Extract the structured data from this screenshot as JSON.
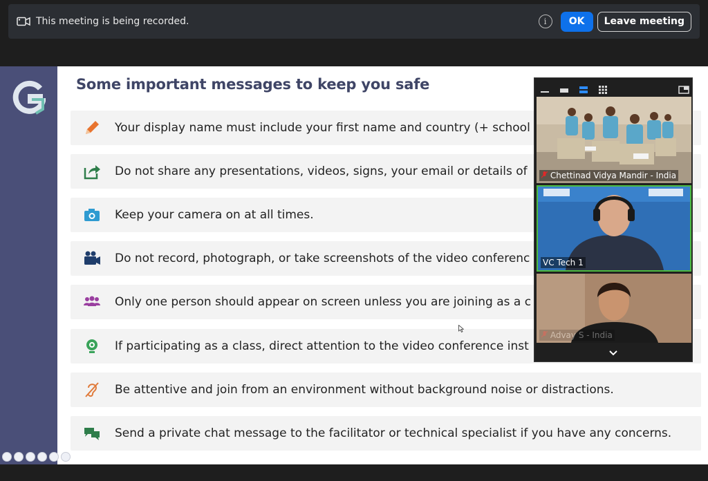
{
  "banner": {
    "message": "This meeting is being recorded.",
    "info_glyph": "i",
    "ok_label": "OK",
    "leave_label": "Leave meeting"
  },
  "slide": {
    "title": "Some important messages to keep you safe",
    "items": [
      {
        "text": "Your display name must include your first name and country (+ school",
        "icon": "pencil-icon",
        "color": "#e8742f"
      },
      {
        "text": "Do not share any presentations, videos, signs, your email or details of",
        "icon": "share-icon",
        "color": "#2e7d4a"
      },
      {
        "text": "Keep your camera on at all times.",
        "icon": "camera-icon",
        "color": "#2f9bd1"
      },
      {
        "text": "Do not record, photograph, or take screenshots of the video conferenc",
        "icon": "video-camera-icon",
        "color": "#1f3d6b"
      },
      {
        "text": "Only one person should appear on screen unless you are joining as a c",
        "icon": "people-icon",
        "color": "#9a3fa0"
      },
      {
        "text": "If participating as a class, direct attention to the video conference inst",
        "icon": "webcam-icon",
        "color": "#3aa35a"
      },
      {
        "text": "Be attentive and join from an environment without background noise or distractions.",
        "icon": "no-hearing-icon",
        "color": "#e07a3a"
      },
      {
        "text": "Send a private chat message to the facilitator or technical specialist if you have any concerns.",
        "icon": "chat-icon",
        "color": "#2e7d4a"
      }
    ]
  },
  "video_panel": {
    "participants": [
      {
        "name": "Chettinad Vidya Mandir - India",
        "muted": true
      },
      {
        "name": "VC Tech 1",
        "muted": false,
        "active_speaker": true
      },
      {
        "name": "Advay S - India",
        "muted": true
      }
    ]
  }
}
